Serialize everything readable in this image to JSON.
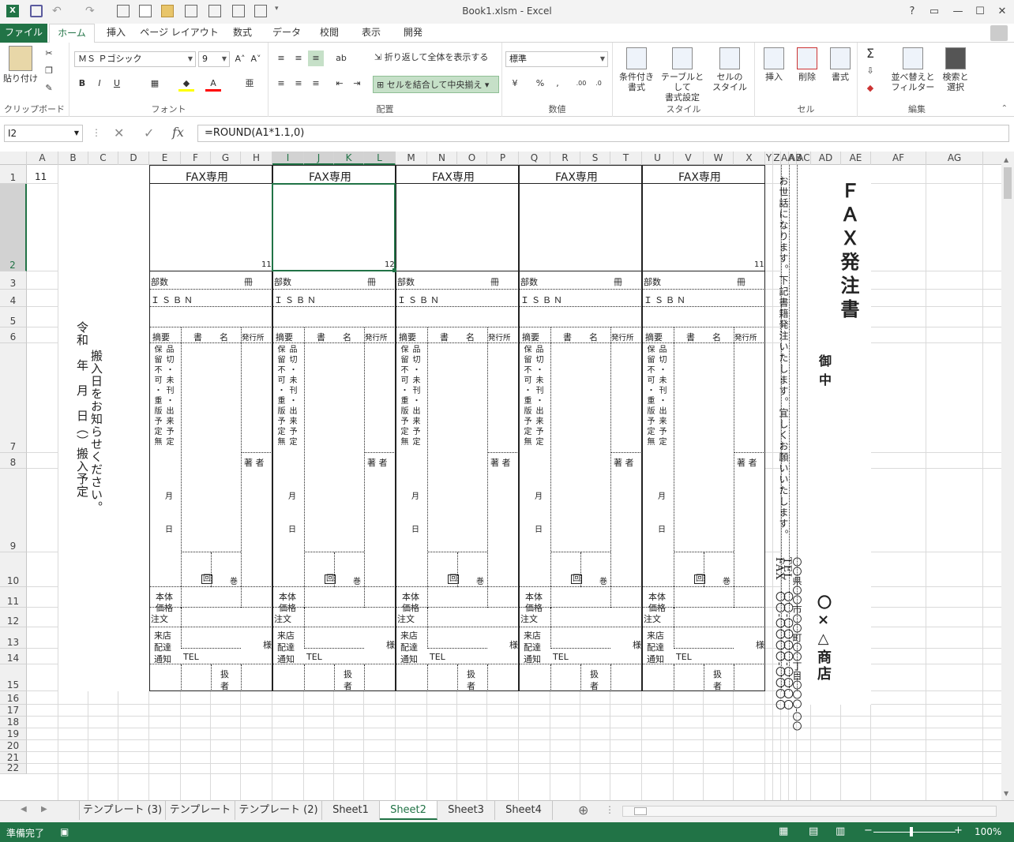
{
  "window": {
    "title": "Book1.xlsm - Excel",
    "help": "?"
  },
  "tabs": [
    "ファイル",
    "ホーム",
    "挿入",
    "ページ レイアウト",
    "数式",
    "データ",
    "校閲",
    "表示",
    "開発"
  ],
  "ribbon": {
    "clipboard": {
      "paste": "貼り付け",
      "label": "クリップボード"
    },
    "font": {
      "name": "ＭＳ Ｐゴシック",
      "size": "9",
      "bold": "B",
      "italic": "I",
      "underline": "U",
      "label": "フォント"
    },
    "align": {
      "wrap": "折り返して全体を表示する",
      "merge": "セルを結合して中央揃え",
      "label": "配置"
    },
    "number": {
      "format": "標準",
      "percent": "%",
      "comma": ",",
      "label": "数値"
    },
    "styles": {
      "cond": [
        "条件付き",
        "書式"
      ],
      "table": [
        "テーブルとして",
        "書式設定"
      ],
      "cell": [
        "セルの",
        "スタイル"
      ],
      "label": "スタイル"
    },
    "cells": {
      "insert": "挿入",
      "delete": "削除",
      "format": "書式",
      "label": "セル"
    },
    "editing": {
      "sort": [
        "並べ替えと",
        "フィルター"
      ],
      "find": [
        "検索と",
        "選択"
      ],
      "label": "編集"
    }
  },
  "formula_bar": {
    "name_box": "I2",
    "fx": "fx",
    "formula": "=ROUND(A1*1.1,0)"
  },
  "columns": [
    "A",
    "B",
    "C",
    "D",
    "E",
    "F",
    "G",
    "H",
    "I",
    "J",
    "K",
    "L",
    "M",
    "N",
    "O",
    "P",
    "Q",
    "R",
    "S",
    "T",
    "U",
    "V",
    "W",
    "X",
    "Y",
    "Z",
    "AA",
    "AB",
    "AC",
    "AD",
    "AE",
    "AF",
    "AG"
  ],
  "rows": [
    "1",
    "2",
    "3",
    "4",
    "5",
    "6",
    "7",
    "8",
    "9",
    "10",
    "11",
    "12",
    "13",
    "14",
    "15",
    "16",
    "17",
    "18",
    "19",
    "20",
    "21",
    "22"
  ],
  "sheet": {
    "a1": "11",
    "slips": [
      {
        "top_value": "11"
      },
      {
        "top_value": "12"
      },
      {
        "top_value": ""
      },
      {
        "top_value": ""
      },
      {
        "top_value": "11"
      }
    ],
    "slip_labels": {
      "fax": "FAX専用",
      "busu": "部数",
      "satsu": "冊",
      "isbn": "ＩＳＢＮ",
      "tekiyo": "摘要",
      "shomei": "書　　名",
      "hakko": "発行所",
      "chosha": "著 者",
      "col1": "保留不可・重版予定無",
      "col2": "品切・未刊・出来予定",
      "month": "月",
      "day": "日",
      "kai": "回",
      "kan": "巻",
      "hontai": [
        "本体",
        "価格"
      ],
      "chumon": "注文",
      "raiten": [
        "来店",
        "配達",
        "通知"
      ],
      "sama": "様",
      "tel": "TEL",
      "atsukai": [
        "扱",
        "者"
      ]
    },
    "left_notice": [
      "搬入日をお知らせください。",
      "令和　年　月　日（）搬入予定"
    ],
    "right_notice": "お世話になります。下記書籍発注いたします。宜しくお願いいたします。",
    "address": "〇〇県〇〇市〇〇町〇〇丁目〇〇〇-〇〇",
    "tel": "TEL　〇〇-〇〇〇〇-〇〇〇〇",
    "fax": "FAX　〇〇-〇〇〇〇-〇〇〇〇",
    "shop": "〇×△商店",
    "onchu": "御中",
    "title": "ＦＡＸ発注書"
  },
  "sheet_tabs": [
    "テンプレート (3)",
    "テンプレート",
    "テンプレート (2)",
    "Sheet1",
    "Sheet2",
    "Sheet3",
    "Sheet4"
  ],
  "active_sheet": "Sheet2",
  "status": {
    "ready": "準備完了",
    "zoom": "100%"
  },
  "colors": {
    "accent": "#217346"
  }
}
